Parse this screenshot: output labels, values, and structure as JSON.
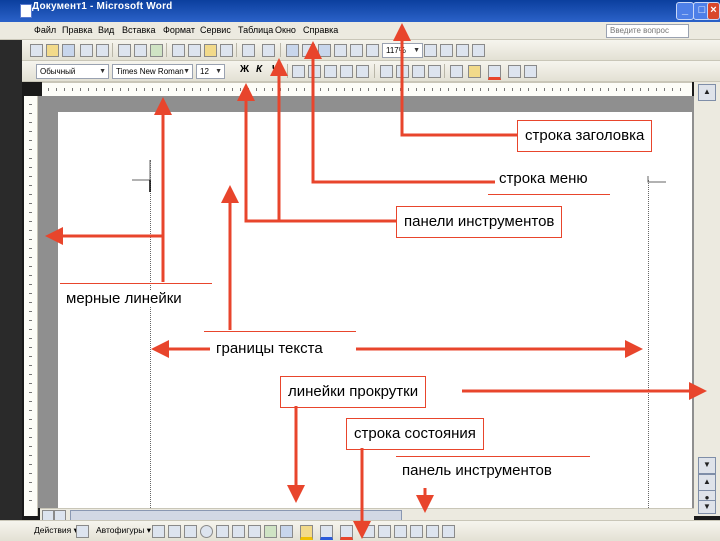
{
  "window": {
    "title": "Документ1 - Microsoft Word",
    "controls": [
      "_",
      "□",
      "×"
    ]
  },
  "menubar": {
    "items": [
      "Файл",
      "Правка",
      "Вид",
      "Вставка",
      "Формат",
      "Сервис",
      "Таблица",
      "Окно",
      "Справка"
    ],
    "ask_placeholder": "Введите вопрос"
  },
  "formatting": {
    "style": "Обычный",
    "font": "Times New Roman",
    "size": "12",
    "zoom": "117%",
    "bold": "Ж",
    "italic": "К",
    "underline": "Ч"
  },
  "drawing": {
    "actions_label": "Действия ▾",
    "autoshapes_label": "Автофигуры ▾"
  },
  "annotations": {
    "title_bar": "строка заголовка",
    "menu_bar": "строка меню",
    "toolbars": "панели инструментов",
    "rulers": "мерные линейки",
    "text_bounds": "границы текста",
    "scrollbars": "линейки прокрутки",
    "status_bar": "строка состояния",
    "toolbar_single": "панель инструментов"
  },
  "colors": {
    "accent": "#e8452c",
    "titlebar": "#0b3f9e"
  }
}
